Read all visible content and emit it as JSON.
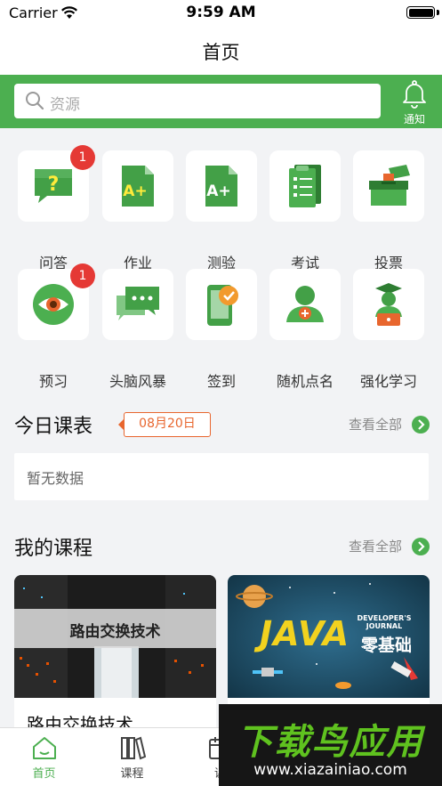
{
  "status_bar": {
    "carrier": "Carrier",
    "time": "9:59 AM",
    "battery_percent": 100
  },
  "navbar": {
    "title": "首页"
  },
  "search": {
    "placeholder": "资源",
    "notify_label": "通知"
  },
  "features": [
    {
      "label": "问答",
      "icon": "qa-icon",
      "badge": "1"
    },
    {
      "label": "作业",
      "icon": "homework-icon",
      "badge": ""
    },
    {
      "label": "测验",
      "icon": "quiz-icon",
      "badge": ""
    },
    {
      "label": "考试",
      "icon": "exam-icon",
      "badge": ""
    },
    {
      "label": "投票",
      "icon": "vote-icon",
      "badge": ""
    },
    {
      "label": "预习",
      "icon": "preview-eye-icon",
      "badge": "1"
    },
    {
      "label": "头脑风暴",
      "icon": "brainstorm-icon",
      "badge": ""
    },
    {
      "label": "签到",
      "icon": "checkin-phone-icon",
      "badge": ""
    },
    {
      "label": "随机点名",
      "icon": "random-call-icon",
      "badge": ""
    },
    {
      "label": "强化学习",
      "icon": "study-icon",
      "badge": ""
    }
  ],
  "today_schedule": {
    "title": "今日课表",
    "date": "08月20日",
    "view_all": "查看全部",
    "empty_text": "暂无数据"
  },
  "my_courses": {
    "title": "我的课程",
    "view_all": "查看全部",
    "courses": [
      {
        "name": "路由交换技术",
        "banner_text": "路由交换技术"
      },
      {
        "name": "",
        "banner_text": "JAVA",
        "banner_sub": "DEVELOPER'S JOURNAL",
        "banner_cn": "零基础"
      }
    ]
  },
  "tabbar": {
    "tabs": [
      {
        "label": "首页",
        "icon": "home-icon"
      },
      {
        "label": "课程",
        "icon": "books-icon"
      },
      {
        "label": "课",
        "icon": "calendar-icon"
      }
    ]
  },
  "watermark": {
    "title": "下载鸟应用",
    "url": "www.xiazainiao.com"
  },
  "colors": {
    "accent": "#4caf50",
    "badge": "#e53935",
    "date_tag": "#e8662e"
  }
}
